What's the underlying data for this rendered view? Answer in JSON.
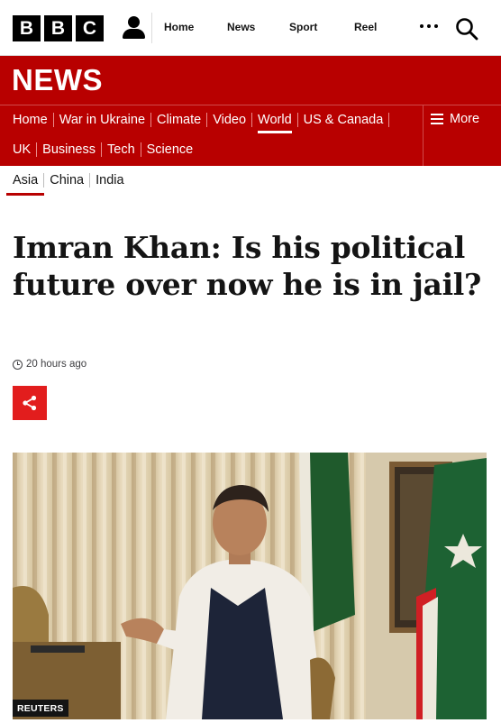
{
  "header": {
    "logo_letters": [
      "B",
      "B",
      "C"
    ],
    "nav": [
      "Home",
      "News",
      "Sport",
      "Reel"
    ]
  },
  "section": {
    "title": "NEWS"
  },
  "main_nav": {
    "row1": [
      "Home",
      "War in Ukraine",
      "Climate",
      "Video",
      "World",
      "US & Canada"
    ],
    "row2": [
      "UK",
      "Business",
      "Tech",
      "Science"
    ],
    "active": "World",
    "more_label": "More"
  },
  "sub_nav": {
    "items": [
      "Asia",
      "China",
      "India"
    ],
    "active": "Asia"
  },
  "article": {
    "headline": "Imran Khan: Is his political future over now he is in jail?",
    "timestamp": "20 hours ago",
    "image_credit": "REUTERS"
  },
  "colors": {
    "brand_red": "#b80000",
    "share_red": "#e21d1d"
  }
}
